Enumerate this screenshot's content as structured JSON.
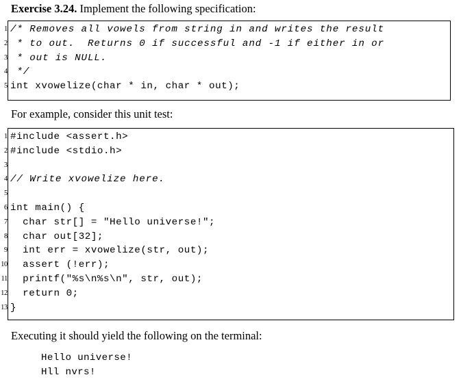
{
  "document": {
    "exercise_heading": {
      "label": "Exercise 3.24.",
      "rest": " Implement the following specification:"
    },
    "for_example_line": "For example, consider this unit test:",
    "executing_line": "Executing it should yield the following on the terminal:"
  },
  "spec_listing": {
    "line_numbers": [
      "1",
      "2",
      "3",
      "4",
      "5"
    ],
    "lines": [
      {
        "n": "1",
        "text": "/* Removes all vowels from string in and writes the result",
        "style": "comment"
      },
      {
        "n": "2",
        "text": " * to out.  Returns 0 if successful and -1 if either in or",
        "style": "comment"
      },
      {
        "n": "3",
        "text": " * out is NULL.",
        "style": "comment"
      },
      {
        "n": "4",
        "text": " */",
        "style": "comment"
      },
      {
        "n": "5",
        "text": "int xvowelize(char * in, char * out);",
        "style": "code"
      }
    ]
  },
  "test_listing": {
    "line_numbers": [
      "1",
      "2",
      "3",
      "4",
      "5",
      "6",
      "7",
      "8",
      "9",
      "10",
      "11",
      "12",
      "13"
    ],
    "lines": [
      {
        "n": "1",
        "text": "#include <assert.h>",
        "style": "code"
      },
      {
        "n": "2",
        "text": "#include <stdio.h>",
        "style": "code"
      },
      {
        "n": "3",
        "text": "",
        "style": "blank"
      },
      {
        "n": "4",
        "text": "// Write xvowelize here.",
        "style": "comment"
      },
      {
        "n": "5",
        "text": "",
        "style": "blank"
      },
      {
        "n": "6",
        "text": "int main() {",
        "style": "code"
      },
      {
        "n": "7",
        "text": "  char str[] = \"Hello universe!\";",
        "style": "code"
      },
      {
        "n": "8",
        "text": "  char out[32];",
        "style": "code"
      },
      {
        "n": "9",
        "text": "  int err = xvowelize(str, out);",
        "style": "code"
      },
      {
        "n": "10",
        "text": "  assert (!err);",
        "style": "code"
      },
      {
        "n": "11",
        "text": "  printf(\"%s\\n%s\\n\", str, out);",
        "style": "code"
      },
      {
        "n": "12",
        "text": "  return 0;",
        "style": "code"
      },
      {
        "n": "13",
        "text": "}",
        "style": "code"
      }
    ]
  },
  "terminal_output": {
    "lines": [
      "Hello universe!",
      "Hll nvrs!"
    ]
  },
  "colors": {
    "text": "#000000",
    "background": "#ffffff",
    "border": "#000000"
  }
}
